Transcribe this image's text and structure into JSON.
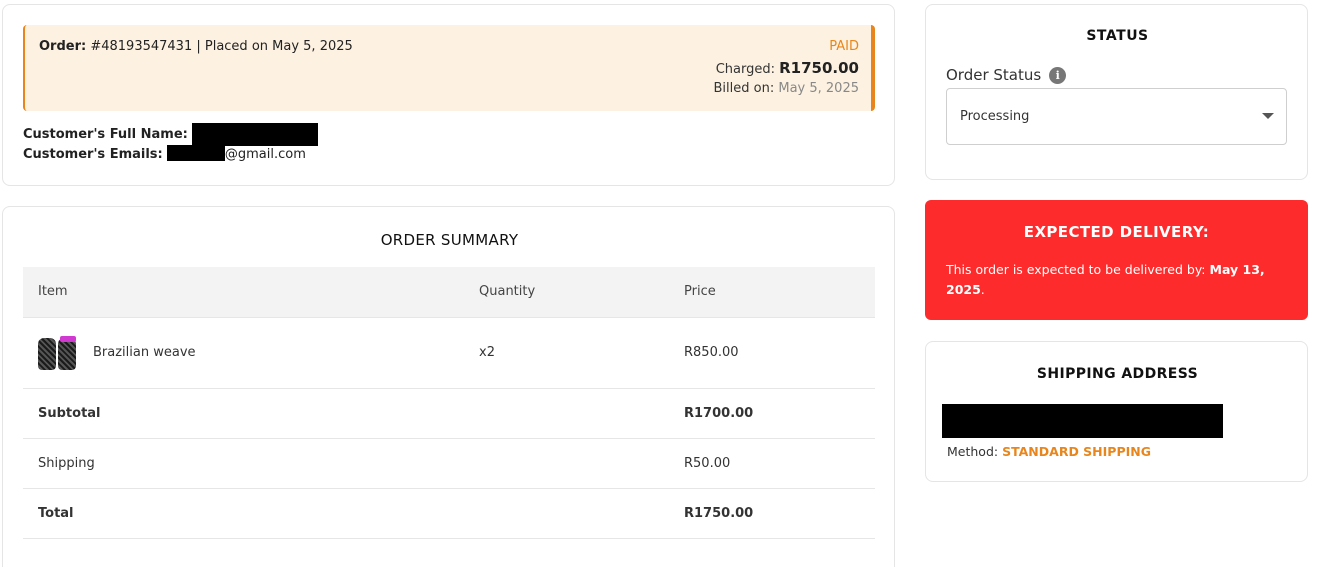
{
  "order": {
    "label": "Order:",
    "number": "#48193547431",
    "placed": "| Placed on May 5, 2025",
    "status": "PAID",
    "charged_label": "Charged:",
    "charged_amount": "R1750.00",
    "billed_label": "Billed on:",
    "billed_date": "May 5, 2025"
  },
  "customer": {
    "name_label": "Customer's Full Name:",
    "emails_label": "Customer's Emails:",
    "email_suffix": "@gmail.com"
  },
  "summary": {
    "title": "ORDER SUMMARY",
    "headers": [
      "Item",
      "Quantity",
      "Price"
    ],
    "items": [
      {
        "name": "Brazilian weave",
        "quantity": "x2",
        "price": "R850.00"
      }
    ],
    "subtotal_label": "Subtotal",
    "subtotal_value": "R1700.00",
    "shipping_label": "Shipping",
    "shipping_value": "R50.00",
    "total_label": "Total",
    "total_value": "R1750.00"
  },
  "status_panel": {
    "title": "STATUS",
    "label": "Order Status",
    "info_icon": "info-icon",
    "selected": "Processing"
  },
  "delivery": {
    "title": "EXPECTED DELIVERY:",
    "text": "This order is expected to be delivered by:",
    "date": "May 13, 2025",
    "suffix": "."
  },
  "shipping": {
    "title": "SHIPPING ADDRESS",
    "method_label": "Method:",
    "method_value": "STANDARD SHIPPING"
  },
  "colors": {
    "accent": "#e8861d",
    "banner_bg": "#fdf2e1",
    "delivery_bg": "#fd2b2b"
  }
}
